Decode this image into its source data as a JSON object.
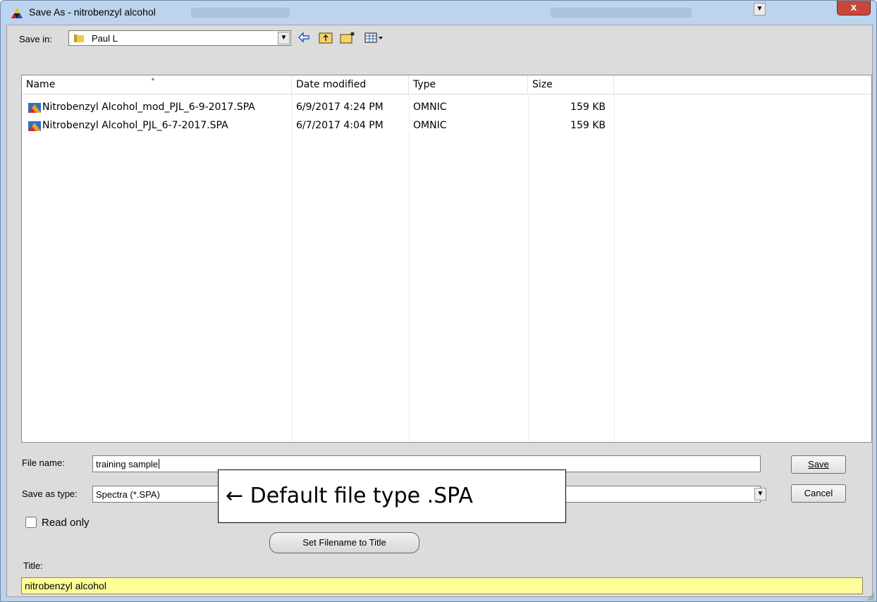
{
  "window": {
    "title": "Save As - nitrobenzyl alcohol",
    "close_label": "x"
  },
  "toolbar": {
    "save_in_label": "Save in:",
    "save_in_value": "Paul L",
    "icons": [
      "back-arrow-icon",
      "up-folder-icon",
      "new-folder-icon",
      "view-menu-icon"
    ]
  },
  "filelist": {
    "columns": [
      "Name",
      "Date modified",
      "Type",
      "Size"
    ],
    "rows": [
      {
        "name": "Nitrobenzyl Alcohol_mod_PJL_6-9-2017.SPA",
        "date": "6/9/2017 4:24 PM",
        "type": "OMNIC",
        "size": "159 KB"
      },
      {
        "name": "Nitrobenzyl Alcohol_PJL_6-7-2017.SPA",
        "date": "6/7/2017 4:04 PM",
        "type": "OMNIC",
        "size": "159 KB"
      }
    ]
  },
  "form": {
    "file_name_label": "File name:",
    "file_name_value": "training sample",
    "save_as_type_label": "Save as type:",
    "save_as_type_value": "Spectra (*.SPA)",
    "save_button": "Save",
    "cancel_button": "Cancel",
    "read_only_label": "Read only",
    "read_only_checked": false,
    "set_filename_button": "Set Filename to Title",
    "title_label": "Title:",
    "title_value": "nitrobenzyl alcohol"
  },
  "annotation": {
    "text": "← Default file type .SPA"
  },
  "colors": {
    "title_field_bg": "#ffff99",
    "titlebar": "#bcd4ee",
    "close_button": "#c8473a"
  }
}
